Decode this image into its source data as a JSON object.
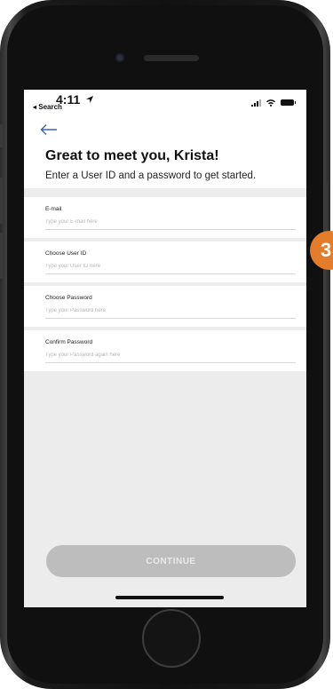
{
  "status_bar": {
    "time": "4:11",
    "back_app": "◂ Search"
  },
  "header": {
    "title": "Great to meet you, Krista!",
    "subtitle": "Enter a User ID and a password to get started."
  },
  "form": {
    "fields": [
      {
        "label": "E-mail",
        "placeholder": "Type your E-mail here",
        "value": ""
      },
      {
        "label": "Choose User ID",
        "placeholder": "Type your User ID here",
        "value": ""
      },
      {
        "label": "Choose Password",
        "placeholder": "Type your Password here",
        "value": ""
      },
      {
        "label": "Confirm Password",
        "placeholder": "Type your Password again here",
        "value": ""
      }
    ]
  },
  "continue_button": {
    "label": "CONTINUE",
    "enabled": false
  },
  "step_badge": {
    "number": "3"
  },
  "colors": {
    "badge": "#e37d2b",
    "back_arrow": "#3b63b5",
    "disabled_button": "#bdbdbd",
    "screen_background": "#ececec"
  },
  "icons": {
    "back": "back-arrow-icon",
    "location": "location-arrow-icon",
    "signal": "cellular-signal-icon",
    "wifi": "wifi-icon",
    "battery": "battery-icon"
  }
}
